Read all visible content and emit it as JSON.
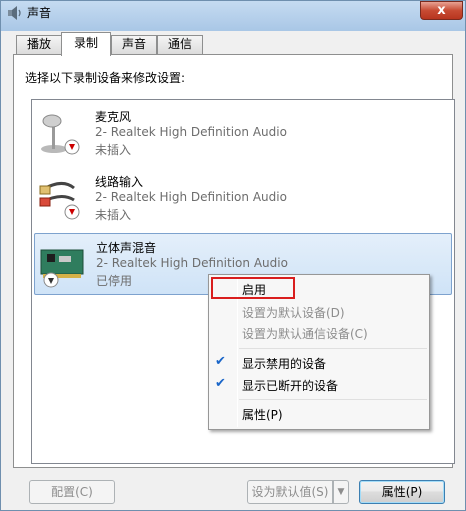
{
  "window": {
    "title": "声音",
    "close_glyph": "x"
  },
  "tabs": [
    {
      "label": "播放",
      "active": false
    },
    {
      "label": "录制",
      "active": true
    },
    {
      "label": "声音",
      "active": false
    },
    {
      "label": "通信",
      "active": false
    }
  ],
  "instruction": "选择以下录制设备来修改设置:",
  "devices": [
    {
      "name": "麦克风",
      "description": "2- Realtek High Definition Audio",
      "status": "未插入",
      "icon": "microphone-icon",
      "selected": false
    },
    {
      "name": "线路输入",
      "description": "2- Realtek High Definition Audio",
      "status": "未插入",
      "icon": "line-in-cable-icon",
      "selected": false
    },
    {
      "name": "立体声混音",
      "description": "2- Realtek High Definition Audio",
      "status": "已停用",
      "icon": "sound-card-icon",
      "selected": true
    }
  ],
  "context_menu": {
    "items": [
      {
        "label": "启用",
        "disabled": false,
        "checked": false,
        "highlighted": true
      },
      {
        "label": "设置为默认设备(D)",
        "disabled": true,
        "checked": false
      },
      {
        "label": "设置为默认通信设备(C)",
        "disabled": true,
        "checked": false
      },
      {
        "label": "显示禁用的设备",
        "disabled": false,
        "checked": true
      },
      {
        "label": "显示已断开的设备",
        "disabled": false,
        "checked": true
      },
      {
        "label": "属性(P)",
        "disabled": false,
        "checked": false
      }
    ]
  },
  "buttons": {
    "configure": "配置(C)",
    "set_default": "设为默认值(S)",
    "properties": "属性(P)"
  },
  "colors": {
    "highlight_border": "#d91e1e",
    "selection_fill": "#cfe3f7",
    "check_color": "#1a66c9"
  }
}
